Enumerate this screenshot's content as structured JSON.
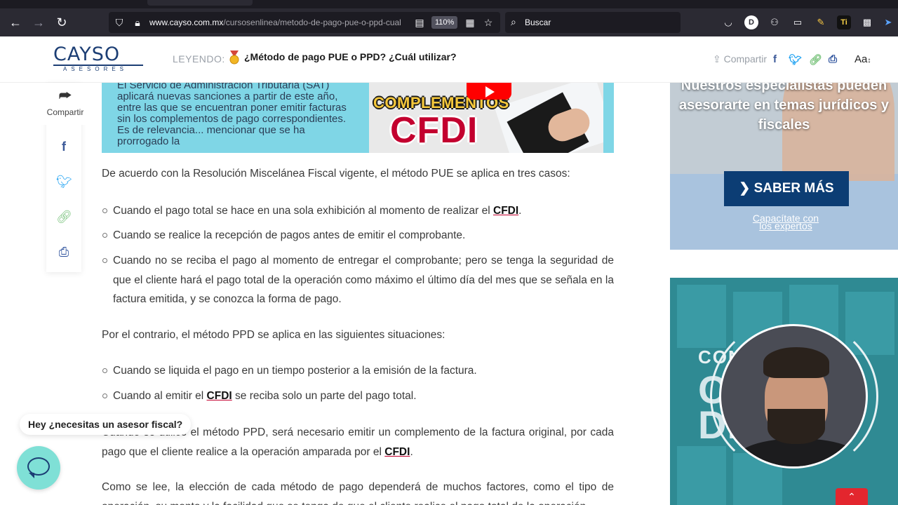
{
  "browser": {
    "url_domain": "www.cayso.com.mx",
    "url_path": "/cursosenlinea/metodo-de-pago-pue-o-ppd-cual",
    "zoom": "110%",
    "search_placeholder": "Buscar",
    "ext_d": "D",
    "ext_ti": "Ti"
  },
  "header": {
    "logo_main": "CAYSO",
    "logo_sub": "ASESORES",
    "reading_label": "LEYENDO:",
    "article_title": "¿Método de pago PUE o PPD? ¿Cuál utilizar?",
    "share_label": "Compartir",
    "font_size_label": "Aa"
  },
  "rail": {
    "share_label": "Compartir"
  },
  "banner": {
    "text": "El Servicio de Administración Tributaria (SAT) aplicará nuevas sanciones a partir de este año, entre las que se encuentran poner emitir facturas sin los complementos de pago correspondientes. Es de relevancia... mencionar que se ha prorrogado la",
    "thumb_line1": "COMPLEMENTOS",
    "thumb_line2": "CFDI"
  },
  "article": {
    "p1": "De acuerdo con la Resolución Miscelánea Fiscal vigente, el método PUE se aplica en tres casos:",
    "pue_items": [
      {
        "text": "Cuando el pago total se hace en una sola exhibición al momento de realizar el ",
        "link": "CFDI",
        "after": "."
      },
      {
        "text": "Cuando se realice la recepción de pagos antes de emitir el comprobante.",
        "link": "",
        "after": ""
      },
      {
        "text": "Cuando no se reciba el pago al momento de entregar el comprobante; pero se tenga la seguridad de que el cliente hará el pago total de la operación como máximo el último día del mes que se señala en la factura emitida, y se conozca la forma de pago.",
        "link": "",
        "after": ""
      }
    ],
    "p2": "Por el contrario, el método PPD se aplica en las siguientes situaciones:",
    "ppd_items": [
      {
        "text": "Cuando se liquida el pago en un tiempo posterior a la emisión de la factura.",
        "link": "",
        "after": ""
      },
      {
        "text": "Cuando al emitir el ",
        "link": "CFDI",
        "after": " se reciba solo un parte del pago total."
      }
    ],
    "p3_before": "Cuando se utilice el método PPD, será necesario emitir un complemento de la factura original, por cada pago que el cliente realice a la operación amparada por el ",
    "p3_link": "CFDI",
    "p3_after": ".",
    "p4": "Como se lee, la elección de cada método de pago dependerá de muchos factores, como el tipo de operación, su monto y la facilidad que se tenga de que el cliente realice el pago total de la operación."
  },
  "chat": {
    "prompt": "Hey ¿necesitas un asesor fiscal?"
  },
  "ads": {
    "ad1_headline": "Nuestros especialistas pueden asesorarte en temas jurídicos y fiscales",
    "ad1_button": "SABER MÁS",
    "ad1_caption": "Capacítate con los expertos",
    "ad2_line1": "CON                RO",
    "ad2_line2": "C",
    "ad2_line3": "DE"
  },
  "colors": {
    "brand_navy": "#1c3e74",
    "link_underline": "#c3002f",
    "banner_bg": "#7fd6e6",
    "facebook": "#3b5998",
    "twitter": "#1da1f2",
    "link_icon": "#7cc47f",
    "print": "#2a4f9b"
  }
}
